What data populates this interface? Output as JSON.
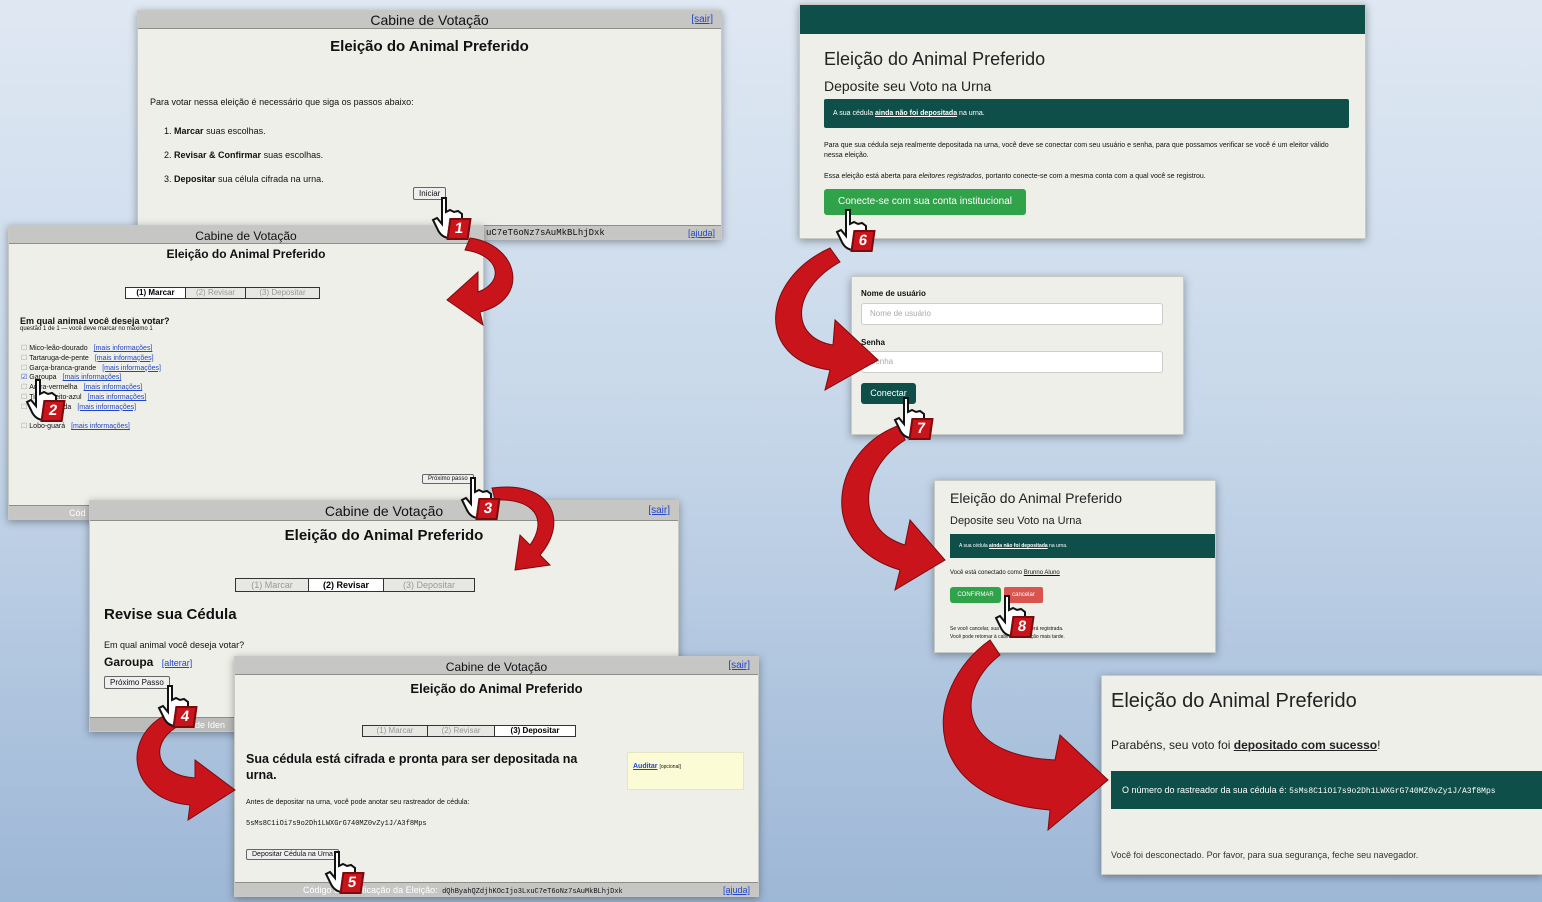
{
  "booth": {
    "title": "Cabine de Votação",
    "logout": "[sair]",
    "help": "[ajuda]",
    "election": "Eleição do Animal Preferido"
  },
  "p1": {
    "intro": "Para votar nessa eleição é necessário que siga os passos abaixo:",
    "steps": [
      {
        "num": "1.",
        "bold": "Marcar",
        "rest": " suas escolhas."
      },
      {
        "num": "2.",
        "bold": "Revisar & Confirmar",
        "rest": " suas escolhas."
      },
      {
        "num": "3.",
        "bold": "Depositar",
        "rest": " sua célula cifrada na urna."
      }
    ],
    "start_button": "Iniciar",
    "hash_fragment": "uC7eT6oNz7sAuMkBLhjDxk"
  },
  "tabs": {
    "mark": "(1) Marcar",
    "review": "(2) Revisar",
    "deposit": "(3) Depositar"
  },
  "p2": {
    "question": "Em qual animal você deseja votar?",
    "subtitle": "questão 1 de 1 — você deve marcar no máximo 1",
    "more_info": "[mais informações]",
    "options": [
      {
        "label": "Mico-leão-dourado",
        "checked": false
      },
      {
        "label": "Tartaruga-de-pente",
        "checked": false
      },
      {
        "label": "Garça-branca-grande",
        "checked": false
      },
      {
        "label": "Garoupa",
        "checked": true
      },
      {
        "label": "Arara-vermelha",
        "checked": false
      },
      {
        "label": "Tiê-de-peito-azul",
        "checked": false
      },
      {
        "label": "Onça-pintada",
        "checked": false
      },
      {
        "label": "Lobo-guará",
        "checked": false
      }
    ],
    "next_button": "Próximo passo",
    "footer_fragment": "Cód"
  },
  "p3": {
    "heading": "Revise sua Cédula",
    "question": "Em qual animal você deseja votar?",
    "answer": "Garoupa",
    "change": "[alterar]",
    "next_button": "Próximo Passo",
    "footer_fragment": "de Iden"
  },
  "p4": {
    "heading": "Sua cédula está cifrada e pronta para ser depositada na urna.",
    "audit": "Auditar",
    "audit_optional": "[opcional]",
    "tracker_note": "Antes de depositar na urna, você pode anotar seu rastreador de cédula:",
    "tracker": "5sMs8C1iOi7s9o2Dh1LWXGrG740MZ0vZy1J/A3f8Mps",
    "deposit_button": "Depositar Cédula na Urna",
    "footer_label": "Código de Verificação da Eleição:",
    "footer_hash": "dQhByahQZdjhKOcIjo3LxuC7eT6oNz7sAuMkBLhjDxk"
  },
  "p6": {
    "heading": "Eleição do Animal Preferido",
    "subheading": "Deposite seu Voto na Urna",
    "alert_pre": "A sua cédula ",
    "alert_bold": "ainda não foi depositada",
    "alert_post": " na urna.",
    "para1": "Para que sua cédula seja realmente depositada na urna, você deve se conectar com seu usuário e senha, para que possamos verificar se você é um eleitor válido nessa eleição.",
    "para2_pre": "Essa eleição está aberta para ",
    "para2_em": "eleitores registrados",
    "para2_post": ", portanto conecte-se com a mesma conta com a qual você se registrou.",
    "connect_button": "Conecte-se com sua conta institucional"
  },
  "p7": {
    "user_label": "Nome de usuário",
    "user_placeholder": "Nome de usuário",
    "pass_label": "Senha",
    "pass_placeholder": "Senha",
    "connect_button": "Conectar"
  },
  "p8": {
    "heading": "Eleição do Animal Preferido",
    "subheading": "Deposite seu Voto na Urna",
    "alert_pre": "A sua cédula ",
    "alert_bold": "ainda não foi depositada",
    "alert_post": " na urna.",
    "connected_pre": "Você está conectado como ",
    "connected_user": "Brunno Aluno",
    "confirm": "CONFIRMAR",
    "cancel": "cancelar",
    "note1": "Se você cancelar, sua cédula NÃO será registrada.",
    "note2": "Você pode retornar à cabine de votação mais tarde."
  },
  "p9": {
    "heading": "Eleição do Animal Preferido",
    "success_pre": "Parabéns, seu voto foi ",
    "success_bold": "depositado com sucesso",
    "success_post": "!",
    "tracker_label": "O número do rastreador da sua cédula é: ",
    "tracker": "5sMs8C1iOi7s9o2Dh1LWXGrG740MZ0vZy1J/A3f8Mps",
    "logout_msg": "Você foi desconectado. Por favor, para sua segurança, feche seu navegador."
  },
  "badges": [
    "1",
    "2",
    "3",
    "4",
    "5",
    "6",
    "7",
    "8"
  ],
  "colors": {
    "teal": "#0f4f4a",
    "green": "#2fa24a",
    "red_arrow": "#c8141a",
    "cancel": "#d9534f"
  }
}
